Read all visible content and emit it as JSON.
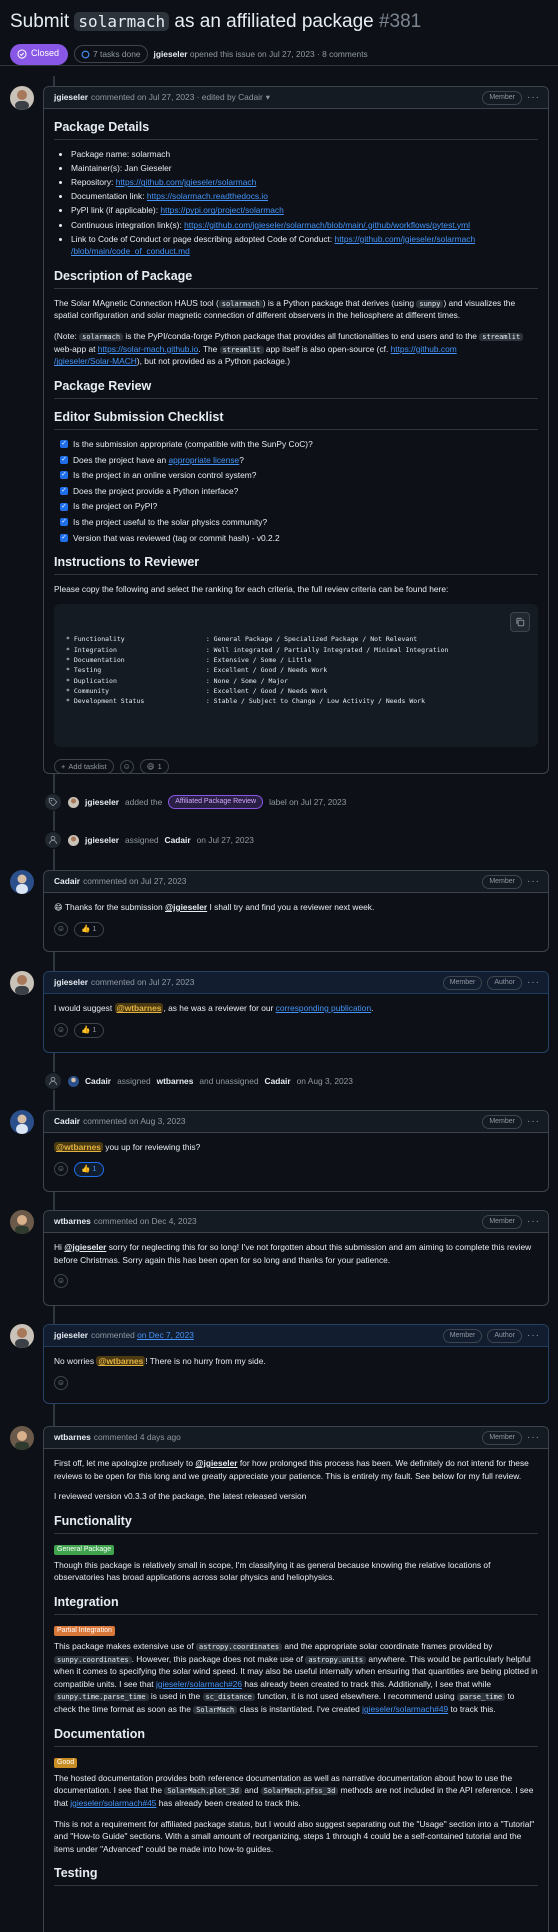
{
  "issue": {
    "title_prefix": "Submit",
    "title_code": "solarmach",
    "title_suffix": "as an affiliated package",
    "number": "#381",
    "state": "Closed",
    "tasks": "7 tasks done",
    "author": "jgieseler",
    "opened_text": "opened this issue on Jul 27, 2023",
    "comments_count": "8 comments"
  },
  "colors": {
    "closed": "#8957e5",
    "link": "#4493f8",
    "mention_highlight": "#e3b341"
  },
  "opening_comment": {
    "author": "jgieseler",
    "date": "commented on Jul 27, 2023",
    "edited": "· edited by Cadair",
    "role": "Member",
    "sections": {
      "package_details": "Package Details",
      "description": "Description of Package",
      "review": "Package Review",
      "checklist_title": "Editor Submission Checklist",
      "instructions": "Instructions to Reviewer"
    },
    "details": {
      "name_label": "Package name: solarmach",
      "maintainer_label": "Maintainer(s): Jan Gieseler",
      "repo_label": "Repository: ",
      "repo_link": "https://github.com/jgieseler/solarmach",
      "docs_label": "Documentation link: ",
      "docs_link": "https://solarmach.readthedocs.io",
      "pypi_label": "PyPI link (if applicable): ",
      "pypi_link": "https://pypi.org/project/solarmach",
      "ci_label": "Continuous integration link(s): ",
      "ci_link": "https://github.com/jgieseler/solarmach/blob/main/.github/workflows/pytest.yml",
      "coc_label": "Link to Code of Conduct or page describing adopted Code of Conduct: ",
      "coc_link_1": "https://github.com/jgieseler/solarmach",
      "coc_link_2": "/blob/main/code_of_conduct.md"
    },
    "desc": {
      "p1_a": "The Solar MAgnetic Connection HAUS tool (",
      "p1_code1": "solarmach",
      "p1_b": ") is a Python package that derives (using ",
      "p1_code2": "sunpy",
      "p1_c": ") and visualizes the spatial configuration and solar magnetic connection of different observers in the heliosphere at different times.",
      "p2_a": "(Note: ",
      "p2_code1": "solarmach",
      "p2_b": " is the PyPI/conda-forge Python package that provides all functionalities to end users and to the ",
      "p2_code2": "streamlit",
      "p2_c": " web-app at ",
      "p2_link1": "https://solar-mach.github.io",
      "p2_d": ". The ",
      "p2_code3": "streamlit",
      "p2_e": " app itself is also open-source (cf. ",
      "p2_link2a": "https://github.com",
      "p2_link2b": "/jgieseler/Solar-MACH",
      "p2_f": "), but not provided as a Python package.)"
    },
    "checklist": [
      {
        "pre": "Is the submission appropriate (compatible with the SunPy CoC)?",
        "link": "",
        "post": ""
      },
      {
        "pre": "Does the project have an ",
        "link": "appropriate license",
        "post": "?"
      },
      {
        "pre": "Is the project in an online version control system?",
        "link": "",
        "post": ""
      },
      {
        "pre": "Does the project provide a Python interface?",
        "link": "",
        "post": ""
      },
      {
        "pre": "Is the project on PyPI?",
        "link": "",
        "post": ""
      },
      {
        "pre": "Is the project useful to the solar physics community?",
        "link": "",
        "post": ""
      },
      {
        "pre": "Version that was reviewed (tag or commit hash) - v0.2.2",
        "link": "",
        "post": ""
      }
    ],
    "instructions_text": "Please copy the following and select the ranking for each criteria, the full review criteria can be found here:",
    "criteria": [
      {
        "name": "Functionality",
        "options": "General Package / Specialized Package / Not Relevant"
      },
      {
        "name": "Integration",
        "options": "Well integrated / Partially Integrated / Minimal Integration"
      },
      {
        "name": "Documentation",
        "options": "Extensive / Some / Little"
      },
      {
        "name": "Testing",
        "options": "Excellent / Good / Needs Work"
      },
      {
        "name": "Duplication",
        "options": "None / Some / Major"
      },
      {
        "name": "Community",
        "options": "Excellent / Good / Needs Work"
      },
      {
        "name": "Development Status",
        "options": "Stable / Subject to Change / Low Activity / Needs Work"
      }
    ],
    "add_tasklist": "Add tasklist",
    "reaction_count": "1"
  },
  "events": {
    "label_event": {
      "actor": "jgieseler",
      "action": "added the",
      "label": "Affiliated Package Review",
      "suffix": "label on Jul 27, 2023"
    },
    "assign_event": {
      "actor": "jgieseler",
      "action": "assigned",
      "target": "Cadair",
      "suffix": "on Jul 27, 2023"
    },
    "reassign_event": {
      "actor": "Cadair",
      "action": "assigned",
      "target": "wtbarnes",
      "middle": "and unassigned",
      "target2": "Cadair",
      "suffix": "on Aug 3, 2023"
    }
  },
  "comments": [
    {
      "author": "Cadair",
      "date": "commented on Jul 27, 2023",
      "roles": [
        "Member"
      ],
      "emoji": "😄",
      "text_a": " Thanks for the submission ",
      "mention": "@jgieseler",
      "text_b": " I shall try and find you a reviewer next week.",
      "reaction": "👍 1"
    },
    {
      "author": "jgieseler",
      "date": "commented on Jul 27, 2023",
      "roles": [
        "Member",
        "Author"
      ],
      "text_a": "I would suggest ",
      "mention": "@wtbarnes",
      "text_b": ", as he was a reviewer for our ",
      "link": "corresponding publication",
      "text_c": ".",
      "reaction": "👍 1"
    },
    {
      "author": "Cadair",
      "date": "commented on Aug 3, 2023",
      "roles": [
        "Member"
      ],
      "mention": "@wtbarnes",
      "text_b": " you up for reviewing this?",
      "reaction": "👍 1"
    },
    {
      "author": "wtbarnes",
      "date": "commented on Dec 4, 2023",
      "roles": [
        "Member"
      ],
      "text_a": "Hi ",
      "mention": "@jgieseler",
      "text_b": " sorry for neglecting this for so long! I've not forgotten about this submission and am aiming to complete this review before Christmas. Sorry again this has been open for so long and thanks for your patience."
    },
    {
      "author": "jgieseler",
      "date_prefix": "commented ",
      "date_link": "on Dec 7, 2023",
      "roles": [
        "Member",
        "Author"
      ],
      "text_a": "No worries ",
      "mention": "@wtbarnes",
      "text_b": "! There is no hurry from my side."
    }
  ],
  "review_comment": {
    "author": "wtbarnes",
    "date": "commented 4 days ago",
    "role": "Member",
    "intro_a": "First off, let me apologize profusely to ",
    "intro_mention": "@jgieseler",
    "intro_b": " for how prolonged this process has been. We definitely do not intend for these reviews to be open for this long and we greatly appreciate your patience. This is entirely my fault. See below for my full review.",
    "reviewed_version": "I reviewed version v0.3.3 of the package, the latest released version",
    "functionality_title": "Functionality",
    "functionality_tag": "General Package",
    "functionality_text": "Though this package is relatively small in scope, I'm classifying it as general because knowing the relative locations of observatories has broad applications across solar physics and heliophysics.",
    "integration_title": "Integration",
    "integration_tag": "Partial Integration",
    "integration": {
      "a": "This package makes extensive use of ",
      "c1": "astropy.coordinates",
      "b": " and the appropriate solar coordinate frames provided by ",
      "c2": "sunpy.coordinates",
      "c": ". However, this package does not make use of ",
      "c3": "astropy.units",
      "d": " anywhere. This would be particularly helpful when it comes to specifying the solar wind speed. It may also be useful internally when ensuring that quantities are being plotted in compatible units. I see that ",
      "l1": "jgieseler/solarmach#26",
      "e": " has already been created to track this. Additionally, I see that while ",
      "c4": "sunpy.time.parse_time",
      "f": " is used in the ",
      "c5": "sc_distance",
      "g": " function, it is not used elsewhere. I recommend using ",
      "c6": "parse_time",
      "h": " to check the time format as soon as the ",
      "c7": "SolarMach",
      "i": " class is instantiated. I've created ",
      "l2": "jgieseler/solarmach#49",
      "j": " to track this."
    },
    "documentation_title": "Documentation",
    "documentation_tag": "Good",
    "documentation": {
      "a": "The hosted documentation provides both reference documentation as well as narrative documentation about how to use the documentation. I see that the ",
      "c1": "SolarMach.plot_3d",
      "b": " and ",
      "c2": "SolarMach.pfss_3d",
      "c": " methods are not included in the API reference. I see that ",
      "l1": "jgieseler/solarmach#45",
      "d": " has already been created to track this.",
      "p2": "This is not a requirement for affiliated package status, but I would also suggest separating out the \"Usage\" section into a \"Tutorial\" and \"How-to Guide\" sections. With a small amount of reorganizing, steps 1 through 4 could be a self-contained tutorial and the items under \"Advanced\" could be made into how-to guides."
    },
    "testing_title": "Testing"
  }
}
